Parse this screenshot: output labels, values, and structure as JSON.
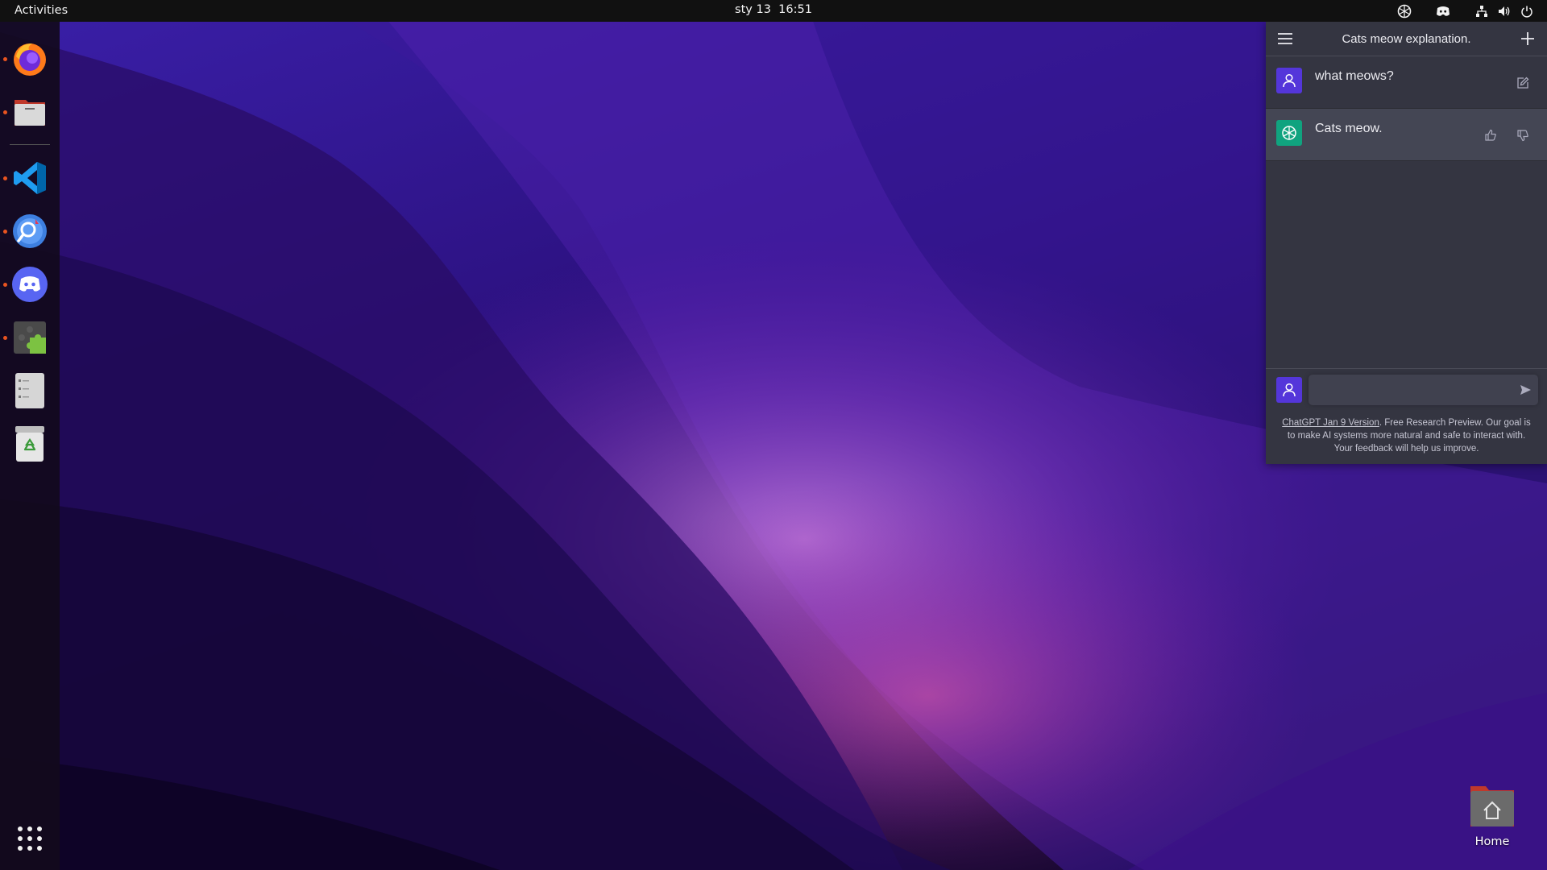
{
  "topbar": {
    "activities": "Activities",
    "clock": "sty 13  16:51",
    "tray": [
      "chatgpt-icon",
      "discord-icon",
      "network-icon",
      "volume-icon",
      "power-icon"
    ]
  },
  "dock": {
    "items": [
      {
        "name": "firefox",
        "running": true
      },
      {
        "name": "files",
        "running": true
      },
      {
        "name": "vscode",
        "running": true
      },
      {
        "name": "web-browser",
        "running": true
      },
      {
        "name": "discord",
        "running": true
      },
      {
        "name": "extensions",
        "running": true
      },
      {
        "name": "text-editor",
        "running": false
      },
      {
        "name": "trash",
        "running": false
      }
    ],
    "apps_grid": "show-applications-icon"
  },
  "chat": {
    "title": "Cats meow explanation.",
    "messages": [
      {
        "role": "user",
        "text": "what meows?"
      },
      {
        "role": "assistant",
        "text": "Cats meow."
      }
    ],
    "input": {
      "value": "",
      "placeholder": ""
    },
    "footer": {
      "link": "ChatGPT Jan 9 Version",
      "text": ". Free Research Preview. Our goal is to make AI systems more natural and safe to interact with. Your feedback will help us improve."
    },
    "colors": {
      "panel": "#343541",
      "bot_row": "#444654",
      "user_avatar": "#5436da",
      "gpt_avatar": "#10a37f"
    }
  },
  "desktop": {
    "home_label": "Home"
  }
}
